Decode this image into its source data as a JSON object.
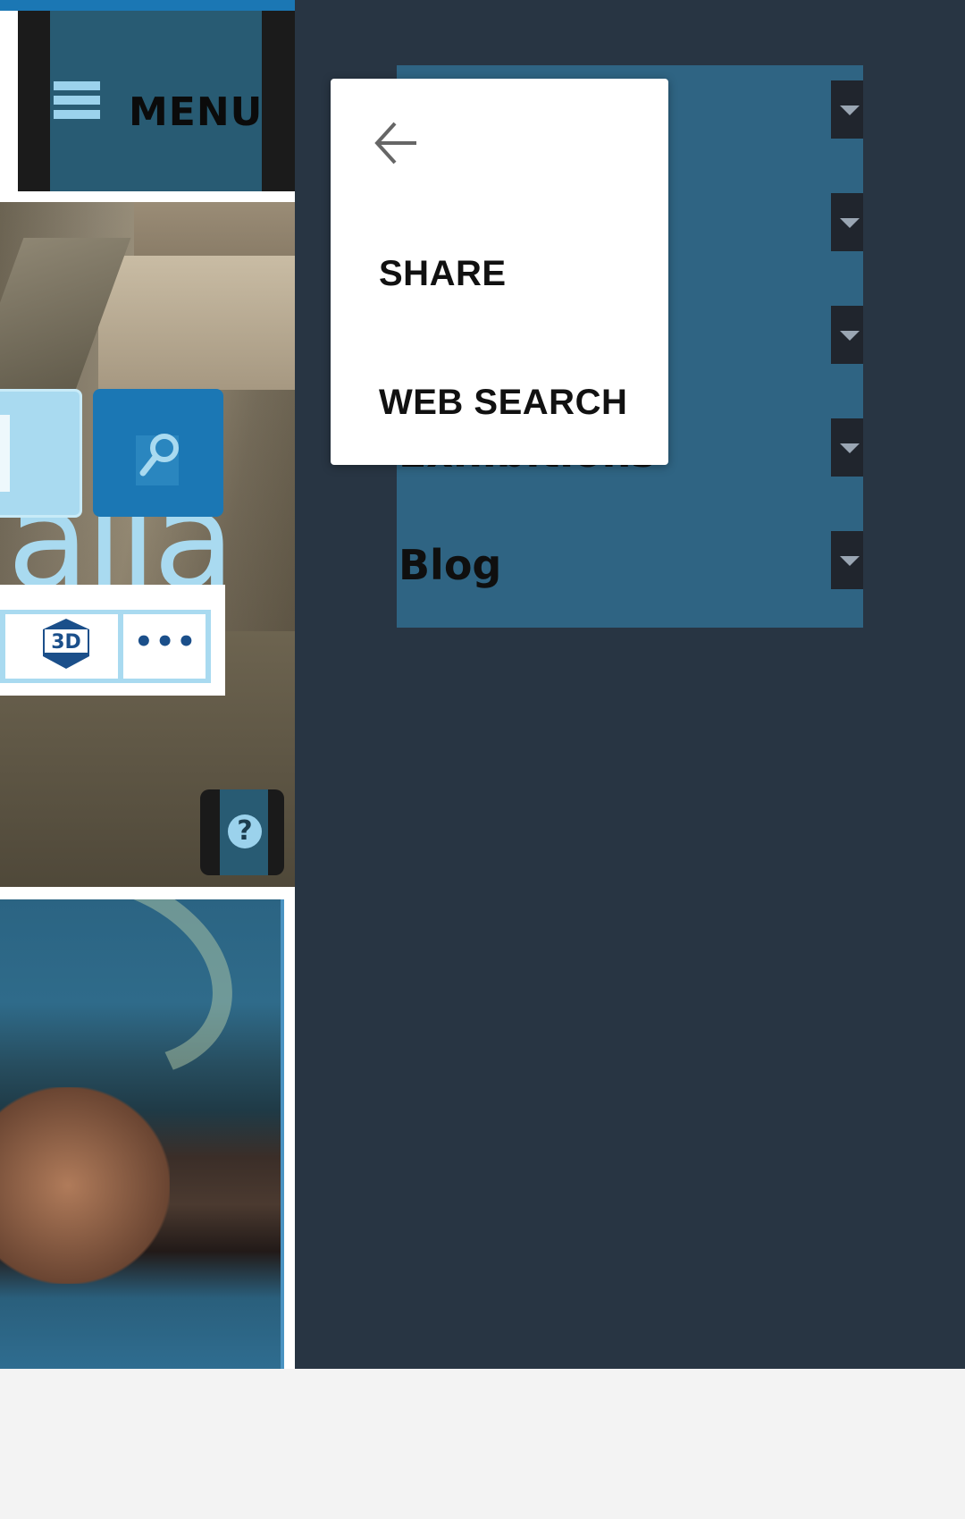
{
  "header": {
    "menu_label": "MENU",
    "hamburger_icon": "hamburger-icon"
  },
  "hero": {
    "search_icon": "search-icon",
    "partial_title_glyphs": "alla",
    "toolbar": {
      "icons": [
        "3d-icon",
        "more-icon"
      ],
      "more_label": "•••"
    },
    "help_label": "?"
  },
  "drawer": {
    "nav_items": [
      {
        "label": ""
      },
      {
        "label": ""
      },
      {
        "label": ""
      },
      {
        "label": "Exhibitions"
      },
      {
        "label": "Blog"
      }
    ],
    "toggle_icon": "chevron-down-icon"
  },
  "context_menu": {
    "back_icon": "arrow-left-icon",
    "items": [
      "SHARE",
      "WEB SEARCH"
    ]
  },
  "colors": {
    "accent_blue": "#1b77b4",
    "drawer_bg": "#283543",
    "nav_bg": "#2f6483",
    "light_blue": "#a9daf0"
  }
}
